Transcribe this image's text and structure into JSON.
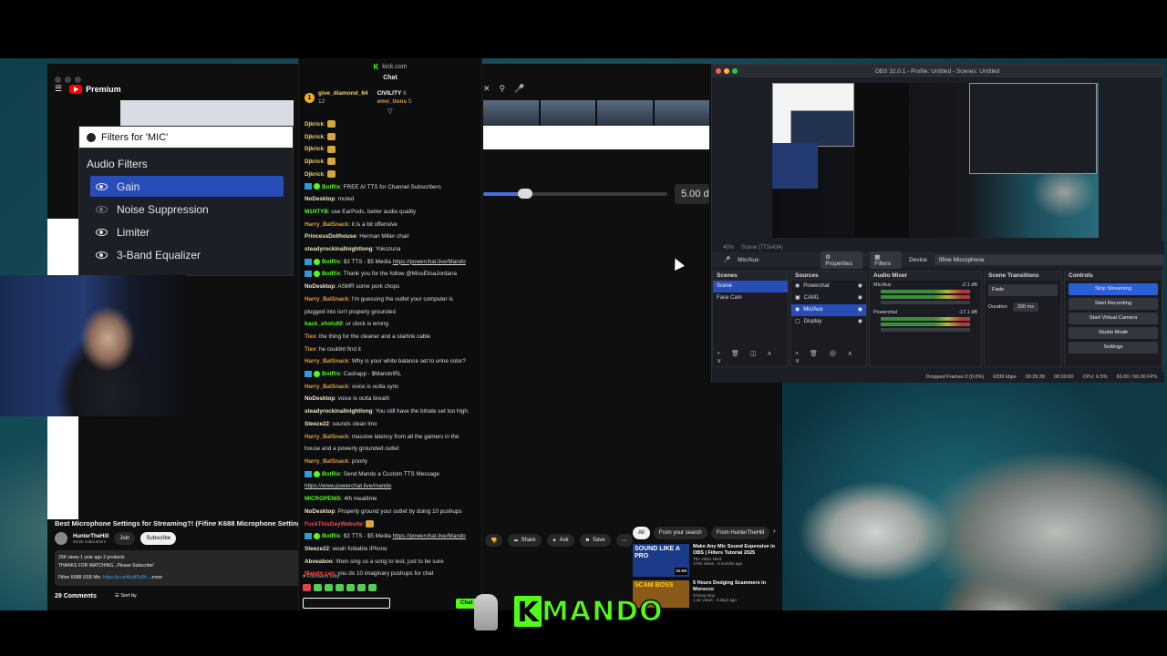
{
  "youtube": {
    "brand": "Premium",
    "filters_window": {
      "title": "Filters for 'MIC'",
      "section": "Audio Filters",
      "items": [
        {
          "label": "Gain",
          "selected": true
        },
        {
          "label": "Noise Suppression",
          "selected": false
        },
        {
          "label": "Limiter",
          "selected": false
        },
        {
          "label": "3-Band Equalizer",
          "selected": false
        }
      ],
      "gain_value": "5.00 d"
    },
    "video_title": "Best Microphone Settings for Streaming?! (Fifine K688 Microphone Settings)",
    "channel": "HunterTheHill",
    "subscribers": "40.6K subscribers",
    "join_label": "Join",
    "subscribe_label": "Subscribe",
    "actions": [
      "Share",
      "Ask",
      "Save"
    ],
    "desc_stats": "25K views  1 year ago  2 products",
    "desc_line1": "THANKS FOR WATCHING...Please Subscribe!",
    "desc_line2_prefix": "Fifine K688 USB Mic:",
    "desc_link": "https://a.co/d/cj4Dx0h",
    "desc_more": "...more",
    "comments_count": "29 Comments",
    "sort_label": "Sort by",
    "filter_chips": [
      "All",
      "From your search",
      "From HunterTheHill"
    ],
    "recommendations": [
      {
        "title": "Make Any Mic Sound Expensive in OBS | Filters Tutorial 2025",
        "channel": "The Video Nerd",
        "meta": "174K views · 5 months ago",
        "duration": "22:00",
        "thumb_text": "SOUND LIKE A PRO"
      },
      {
        "title": "5 Hours Dodging Scammers in Morocco",
        "channel": "Chrissy Boy",
        "meta": "1.1K views · 3 days ago",
        "duration": "",
        "thumb_text": "SCAM BOSS"
      }
    ]
  },
  "chat": {
    "site": "kick.com",
    "title": "Chat",
    "leaderboard": [
      {
        "rank": "1",
        "name": "give_diamond_64",
        "count": "12"
      },
      {
        "rank": "",
        "name": "CIVILITY",
        "count": "6"
      },
      {
        "rank": "",
        "name": "emo_tions",
        "count": "5"
      }
    ],
    "messages": [
      {
        "user": "Djkrick",
        "text": "",
        "color": "#f0d060",
        "bot": false
      },
      {
        "user": "Djkrick",
        "text": "",
        "color": "#f0d060",
        "bot": false
      },
      {
        "user": "Djkrick",
        "text": "",
        "color": "#f0d060",
        "bot": false
      },
      {
        "user": "Djkrick",
        "text": "",
        "color": "#f0d060",
        "bot": false
      },
      {
        "user": "Djkrick",
        "text": "",
        "color": "#f0d060",
        "bot": false
      },
      {
        "user": "BotRix",
        "text": "FREE AI TTS for Channel Subscribers",
        "color": "#53fc18",
        "bot": true
      },
      {
        "user": "NoDesktop",
        "text": "muted",
        "color": "#f0e6c0",
        "bot": false
      },
      {
        "user": "M1NTYB",
        "text": "use EarPods, better audio quality",
        "color": "#53fc18",
        "bot": false
      },
      {
        "user": "Harry_BalSnack",
        "text": "it is a bit offensive",
        "color": "#e39a3b",
        "bot": false
      },
      {
        "user": "PrincessDollhouse",
        "text": "Herman Miller chair",
        "color": "#f0e6c0",
        "bot": false
      },
      {
        "user": "steadyrockinallnightlong",
        "text": "Yokozuna",
        "color": "#f0e6c0",
        "bot": false
      },
      {
        "user": "BotRix",
        "text": "$3 TTS - $5 Media ",
        "link": "https://powerchat.live/Mando",
        "color": "#53fc18",
        "bot": true
      },
      {
        "user": "BotRix",
        "text": "Thank you for the follow @MissElisaJordana",
        "color": "#53fc18",
        "bot": true
      },
      {
        "user": "NoDesktop",
        "text": "ASMR some pork chops",
        "color": "#f0e6c0",
        "bot": false
      },
      {
        "user": "Harry_BalSnack",
        "text": "I'm guessing the outlet your computer is",
        "color": "#e39a3b",
        "bot": false
      },
      {
        "user": "",
        "text": "plugged into isn't properly grounded",
        "color": "#ddd",
        "bot": false
      },
      {
        "user": "back_shots69",
        "text": "ur clock is wrong",
        "color": "#53fc18",
        "bot": false
      },
      {
        "user": "Tiex",
        "text": "the thing for the cleaner and a starlink cable",
        "color": "#e39a3b",
        "bot": false
      },
      {
        "user": "Tiex",
        "text": "he couldnt find it",
        "color": "#e39a3b",
        "bot": false
      },
      {
        "user": "Harry_BalSnack",
        "text": "Why is your white balance set to urine color?",
        "color": "#e39a3b",
        "bot": false
      },
      {
        "user": "BotRix",
        "text": "Cashapp - $MandoIRL",
        "color": "#53fc18",
        "bot": true
      },
      {
        "user": "Harry_BalSnack",
        "text": "voice is outta sync",
        "color": "#e39a3b",
        "bot": false
      },
      {
        "user": "NoDesktop",
        "text": "voice is outta breath",
        "color": "#f0e6c0",
        "bot": false
      },
      {
        "user": "steadyrockinallnightlong",
        "text": "You still have the bitrate set too high.",
        "color": "#f0e6c0",
        "bot": false
      },
      {
        "user": "Steeze22",
        "text": "sounds clean lmo",
        "color": "#f0e6c0",
        "bot": false
      },
      {
        "user": "Harry_BalSnack",
        "text": "massive latency from all the gamers in the",
        "color": "#e39a3b",
        "bot": false
      },
      {
        "user": "",
        "text": "house and a powerly grounded outlet",
        "color": "#ddd",
        "bot": false
      },
      {
        "user": "Harry_BalSnack",
        "text": "poorly",
        "color": "#e39a3b",
        "bot": false
      },
      {
        "user": "BotRix",
        "text": "Send Mando a Custom TTS Message",
        "color": "#53fc18",
        "bot": true
      },
      {
        "user": "",
        "text": "",
        "link": "https://www.powerchat.live/mando",
        "color": "#ddd",
        "bot": false
      },
      {
        "user": "MICROPENIS",
        "text": "4th mealtime",
        "color": "#53fc18",
        "bot": false
      },
      {
        "user": "NoDesktop",
        "text": "Properly ground your outlet by doing 10 pushups",
        "color": "#f0e6c0",
        "bot": false
      },
      {
        "user": "FuckThisGeyWebsite",
        "text": "",
        "color": "#ff4b4b",
        "bot": false
      },
      {
        "user": "BotRix",
        "text": "$3 TTS - $5 Media ",
        "link": "https://powerchat.live/Mando",
        "color": "#53fc18",
        "bot": true
      },
      {
        "user": "Steeze22",
        "text": "woah foldable iPhone",
        "color": "#f0e6c0",
        "bot": false
      },
      {
        "user": "Aboeaboo",
        "text": "!then sing us a song to test, just to be sure",
        "color": "#f0e6c0",
        "bot": false
      },
      {
        "user": "Mando can",
        "text": "you do 10 imaginary pushups for chat",
        "color": "#ff4b4b",
        "bot": false
      }
    ],
    "followers_only": "Followers only",
    "chat_button": "Chat"
  },
  "obs": {
    "title": "OBS 32.0.1 - Profile: Untitled - Scenes: Untitled",
    "zoom": "40%",
    "scene_label": "Scene (773x434)",
    "source_name": "Mic/Aux",
    "properties_label": "Properties",
    "filters_label": "Filters",
    "device_label": "Device",
    "device_value": "fifine Microphone",
    "scenes_header": "Scenes",
    "scenes": [
      "Scene",
      "Face Cam"
    ],
    "sources_header": "Sources",
    "sources": [
      "Powerchat",
      "CAM1",
      "Mic/Aux",
      "Display"
    ],
    "mixer_header": "Audio Mixer",
    "mixer": [
      {
        "name": "Mic/Aux",
        "db": "-2.1 dB"
      },
      {
        "name": "Powerchat",
        "db": "-17.1 dB"
      }
    ],
    "transitions_header": "Scene Transitions",
    "transition": "Fade",
    "duration_label": "Duration",
    "duration_value": "300 ms",
    "controls_header": "Controls",
    "controls": [
      "Stop Streaming",
      "Start Recording",
      "Start Virtual Camera",
      "Studio Mode",
      "Settings"
    ],
    "status": {
      "dropped": "Dropped Frames 0 (0.0%)",
      "bitrate": "6339 kbps",
      "live_time": "00:29:39",
      "rec_time": "00:00:00",
      "cpu": "CPU: 6.5%",
      "fps": "60.00 / 60.00 FPS"
    }
  },
  "logo": {
    "letter": "K",
    "word": "MANDO"
  }
}
